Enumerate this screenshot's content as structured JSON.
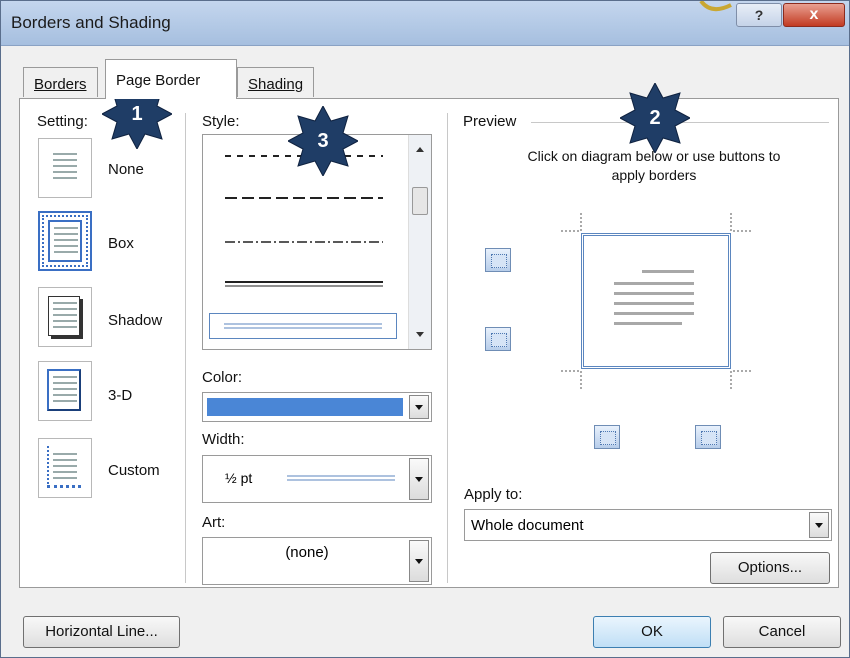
{
  "window": {
    "title": "Borders and Shading",
    "help_label": "?",
    "close_label": "x"
  },
  "tabs": [
    {
      "label": "Borders",
      "active": false
    },
    {
      "label": "Page Border",
      "active": true
    },
    {
      "label": "Shading",
      "active": false
    }
  ],
  "setting": {
    "label": "Setting:",
    "options": [
      {
        "label": "None",
        "selected": false
      },
      {
        "label": "Box",
        "selected": true
      },
      {
        "label": "Shadow",
        "selected": false
      },
      {
        "label": "3-D",
        "selected": false
      },
      {
        "label": "Custom",
        "selected": false
      }
    ]
  },
  "style": {
    "label": "Style:"
  },
  "color": {
    "label": "Color:",
    "value_color": "#4a86d6"
  },
  "width": {
    "label": "Width:",
    "value": "½ pt"
  },
  "art": {
    "label": "Art:",
    "value": "(none)"
  },
  "preview": {
    "label": "Preview",
    "instructions": "Click on diagram below or use buttons to apply borders"
  },
  "apply_to": {
    "label": "Apply to:",
    "value": "Whole document"
  },
  "buttons": {
    "options": "Options...",
    "horizontal_line": "Horizontal Line...",
    "ok": "OK",
    "cancel": "Cancel"
  },
  "badges": [
    "1",
    "2",
    "3"
  ],
  "colors": {
    "badge": "#1f3d66",
    "accent": "#3a6fc4",
    "border_blue": "#5b86bf"
  }
}
